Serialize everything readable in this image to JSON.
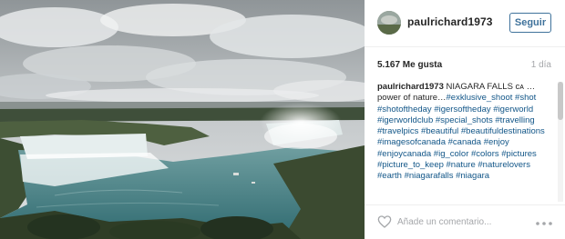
{
  "header": {
    "username": "paulrichard1973",
    "follow_label": "Seguir"
  },
  "stats": {
    "likes": "5.167 Me gusta",
    "time_ago": "1 día"
  },
  "caption": {
    "username": "paulrichard1973",
    "text": " NIAGARA FALLS ᴄᴀ …power of nature…",
    "hashtags": "#exklusive_shoot #shot #shotoftheday #igersoftheday #igerworld #igerworldclub #special_shots #travelling #travelpics #beautiful #beautifuldestinations #imagesofcanada #canada #enjoy #enjoycanada #ig_color #colors #pictures #picture_to_keep #nature #naturelovers #earth #niagarafalls #niagara"
  },
  "footer": {
    "comment_placeholder": "Añade un comentario..."
  },
  "icons": {
    "like": "heart-icon",
    "more": "more-options-icon"
  },
  "colors": {
    "link": "#125688",
    "follow": "#3f729b",
    "muted": "#a5a7aa"
  }
}
